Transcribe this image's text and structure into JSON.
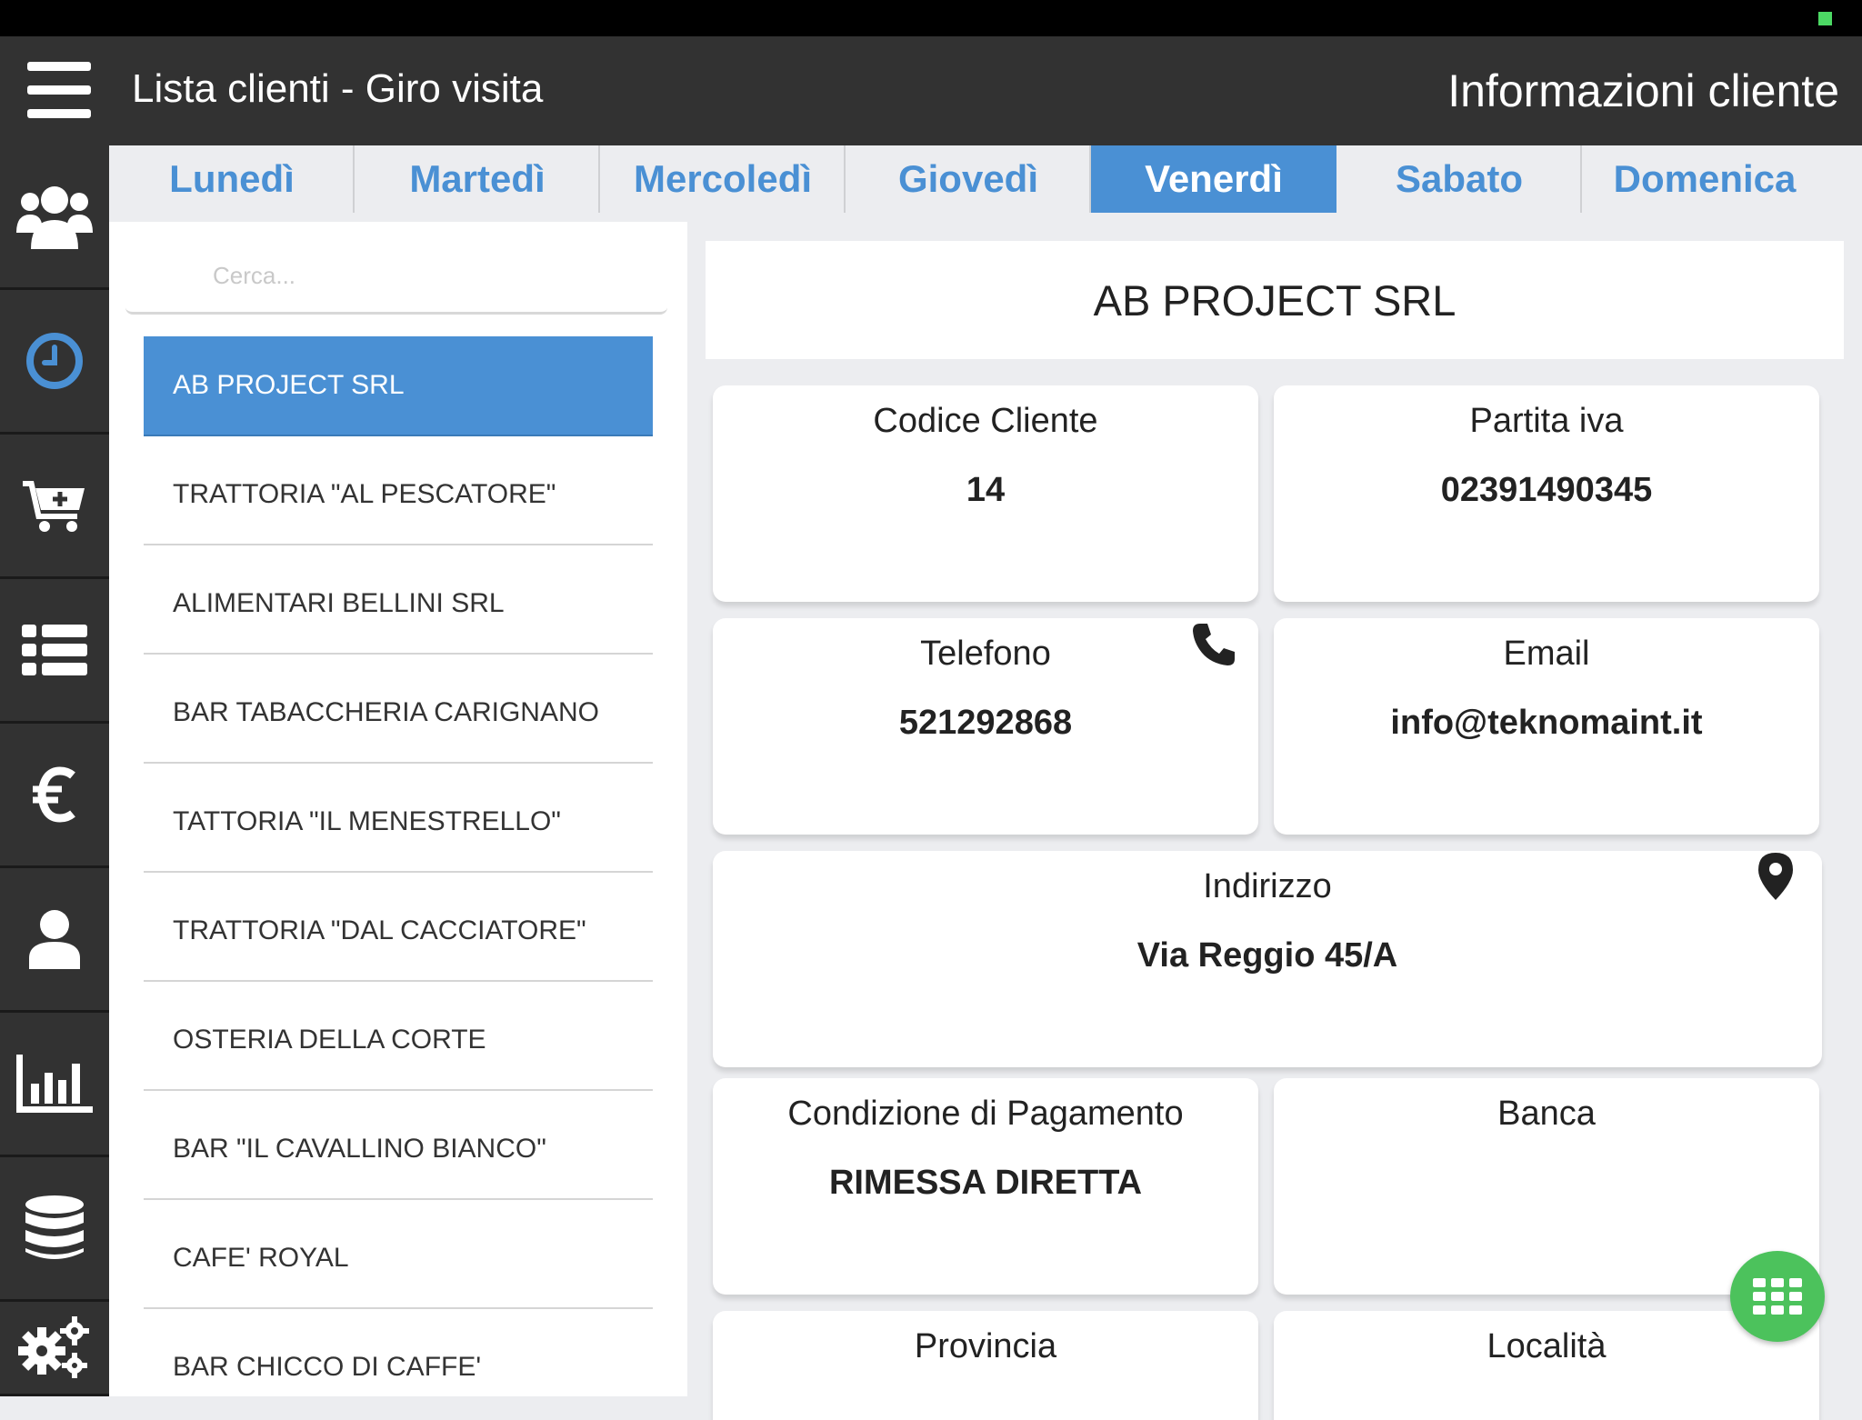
{
  "header": {
    "title": "Lista clienti - Giro visita",
    "right_title": "Informazioni cliente",
    "menu_icon": "hamburger-icon"
  },
  "sidebar": {
    "items": [
      {
        "icon": "users-icon"
      },
      {
        "icon": "clock-icon",
        "active": true
      },
      {
        "icon": "cart-add-icon"
      },
      {
        "icon": "list-icon"
      },
      {
        "icon": "euro-icon"
      },
      {
        "icon": "user-icon"
      },
      {
        "icon": "bar-chart-icon"
      },
      {
        "icon": "database-icon"
      },
      {
        "icon": "gears-icon"
      }
    ]
  },
  "tabs": [
    "Lunedì",
    "Martedì",
    "Mercoledì",
    "Giovedì",
    "Venerdì",
    "Sabato",
    "Domenica"
  ],
  "active_tab": "Venerdì",
  "search": {
    "placeholder": "Cerca..."
  },
  "clients": [
    "AB PROJECT SRL",
    "TRATTORIA \"AL PESCATORE\"",
    "ALIMENTARI BELLINI SRL",
    "BAR TABACCHERIA CARIGNANO",
    "TATTORIA \"IL MENESTRELLO\"",
    "TRATTORIA \"DAL CACCIATORE\"",
    "OSTERIA DELLA CORTE",
    "BAR \"IL CAVALLINO BIANCO\"",
    "CAFE' ROYAL",
    "BAR CHICCO DI CAFFE'"
  ],
  "selected_client": "AB PROJECT SRL",
  "detail": {
    "name": "AB PROJECT SRL",
    "codice_label": "Codice Cliente",
    "codice_value": "14",
    "piva_label": "Partita iva",
    "piva_value": "02391490345",
    "telefono_label": "Telefono",
    "telefono_value": "521292868",
    "email_label": "Email",
    "email_value": "info@teknomaint.it",
    "indirizzo_label": "Indirizzo",
    "indirizzo_value": "Via Reggio 45/A",
    "pagamento_label": "Condizione di Pagamento",
    "pagamento_value": "RIMESSA DIRETTA",
    "banca_label": "Banca",
    "banca_value": "",
    "provincia_label": "Provincia",
    "localita_label": "Località"
  },
  "colors": {
    "accent": "#4a90d4",
    "header_bg": "#323232",
    "page_bg": "#ecedf0",
    "fab": "#4cc25c"
  },
  "fab_icon": "grid-icon"
}
